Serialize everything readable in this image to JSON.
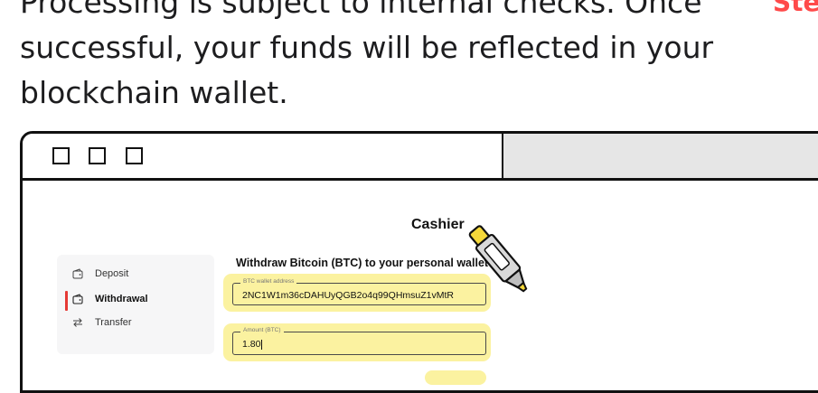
{
  "caption": {
    "lines": [
      "Processing is subject to internal checks. Once",
      "successful, your funds will be reflected in your",
      "blockchain wallet."
    ],
    "step_tag": "Step"
  },
  "window": {
    "title": "Cashier",
    "sidebar": {
      "items": [
        {
          "label": "Deposit",
          "icon": "wallet-icon",
          "active": false
        },
        {
          "label": "Withdrawal",
          "icon": "wallet-icon",
          "active": true
        },
        {
          "label": "Transfer",
          "icon": "transfer-arrows-icon",
          "active": false
        }
      ]
    },
    "form": {
      "heading": "Withdraw Bitcoin (BTC) to your personal wallet",
      "address_field": {
        "label": "BTC wallet address",
        "value": "2NC1W1m36cDAHUyQGB2o4q99QHmsuZ1vMtR"
      },
      "amount_field": {
        "label": "Amount (BTC)",
        "value": "1.80"
      }
    }
  },
  "colors": {
    "highlight": "#fbf2a0",
    "accent_red": "#e53935",
    "step_tag": "#ff4a4a",
    "marker_yellow": "#f5d83a"
  }
}
